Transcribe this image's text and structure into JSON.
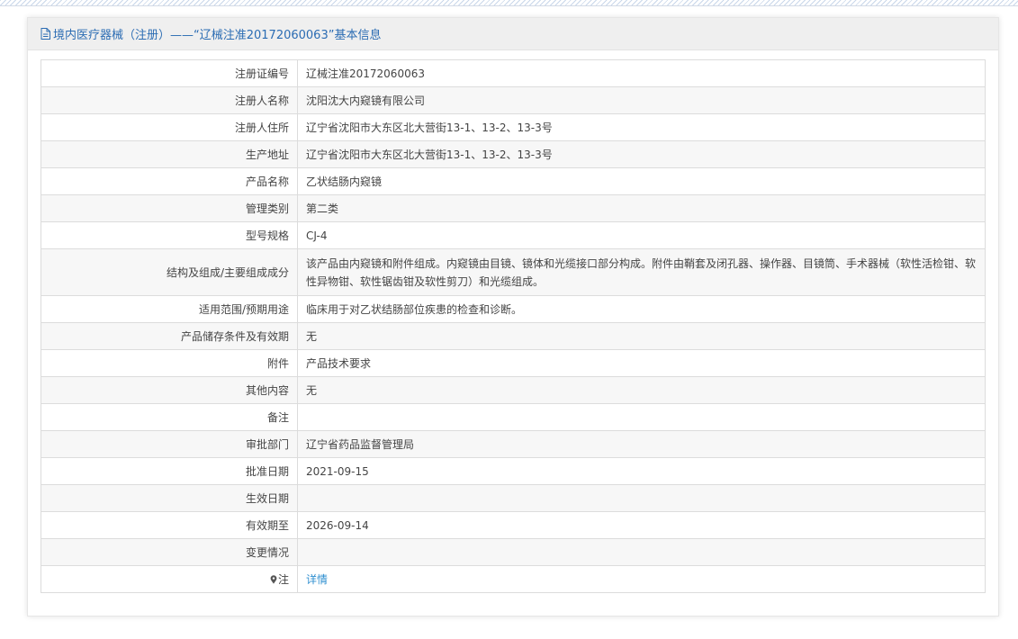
{
  "header": {
    "title": "境内医疗器械（注册）——“辽械注准20172060063”基本信息"
  },
  "rows": [
    {
      "label": "注册证编号",
      "value": "辽械注准20172060063"
    },
    {
      "label": "注册人名称",
      "value": "沈阳沈大内窥镜有限公司"
    },
    {
      "label": "注册人住所",
      "value": "辽宁省沈阳市大东区北大营街13-1、13-2、13-3号"
    },
    {
      "label": "生产地址",
      "value": "辽宁省沈阳市大东区北大营街13-1、13-2、13-3号"
    },
    {
      "label": "产品名称",
      "value": "乙状结肠内窥镜"
    },
    {
      "label": "管理类别",
      "value": "第二类"
    },
    {
      "label": "型号规格",
      "value": "CJ-4"
    },
    {
      "label": "结构及组成/主要组成成分",
      "value": "该产品由内窥镜和附件组成。内窥镜由目镜、镜体和光缆接口部分构成。附件由鞘套及闭孔器、操作器、目镜筒、手术器械（软性活检钳、软性异物钳、软性锯齿钳及软性剪刀）和光缆组成。"
    },
    {
      "label": "适用范围/预期用途",
      "value": "临床用于对乙状结肠部位疾患的检查和诊断。"
    },
    {
      "label": "产品储存条件及有效期",
      "value": "无"
    },
    {
      "label": "附件",
      "value": "产品技术要求"
    },
    {
      "label": "其他内容",
      "value": "无"
    },
    {
      "label": "备注",
      "value": ""
    },
    {
      "label": "审批部门",
      "value": "辽宁省药品监督管理局"
    },
    {
      "label": "批准日期",
      "value": "2021-09-15"
    },
    {
      "label": "生效日期",
      "value": ""
    },
    {
      "label": "有效期至",
      "value": "2026-09-14"
    },
    {
      "label": "变更情况",
      "value": ""
    }
  ],
  "note": {
    "label": "注",
    "link_text": "详情",
    "icon": "map-pin-icon"
  },
  "colors": {
    "title": "#2b6cb3",
    "link": "#2f8fd0",
    "header_bg": "#efefef",
    "row_alt_bg": "#f7f7f7"
  }
}
